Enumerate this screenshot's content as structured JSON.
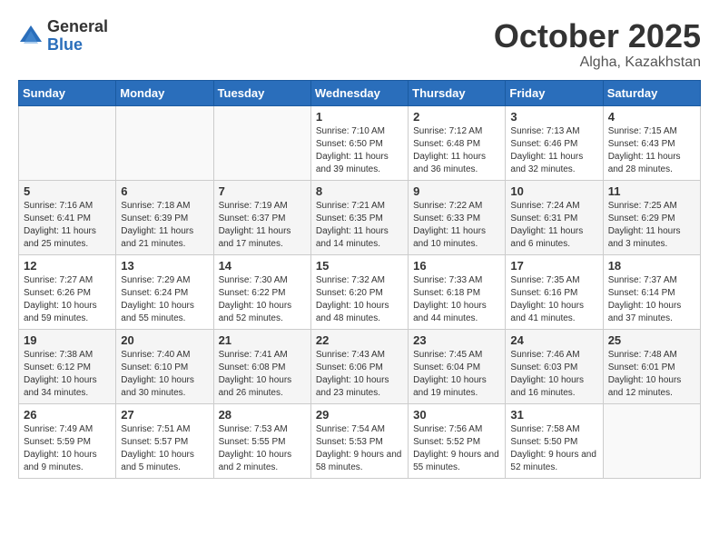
{
  "header": {
    "logo_general": "General",
    "logo_blue": "Blue",
    "month": "October 2025",
    "location": "Algha, Kazakhstan"
  },
  "weekdays": [
    "Sunday",
    "Monday",
    "Tuesday",
    "Wednesday",
    "Thursday",
    "Friday",
    "Saturday"
  ],
  "weeks": [
    [
      {
        "day": "",
        "info": ""
      },
      {
        "day": "",
        "info": ""
      },
      {
        "day": "",
        "info": ""
      },
      {
        "day": "1",
        "info": "Sunrise: 7:10 AM\nSunset: 6:50 PM\nDaylight: 11 hours and 39 minutes."
      },
      {
        "day": "2",
        "info": "Sunrise: 7:12 AM\nSunset: 6:48 PM\nDaylight: 11 hours and 36 minutes."
      },
      {
        "day": "3",
        "info": "Sunrise: 7:13 AM\nSunset: 6:46 PM\nDaylight: 11 hours and 32 minutes."
      },
      {
        "day": "4",
        "info": "Sunrise: 7:15 AM\nSunset: 6:43 PM\nDaylight: 11 hours and 28 minutes."
      }
    ],
    [
      {
        "day": "5",
        "info": "Sunrise: 7:16 AM\nSunset: 6:41 PM\nDaylight: 11 hours and 25 minutes."
      },
      {
        "day": "6",
        "info": "Sunrise: 7:18 AM\nSunset: 6:39 PM\nDaylight: 11 hours and 21 minutes."
      },
      {
        "day": "7",
        "info": "Sunrise: 7:19 AM\nSunset: 6:37 PM\nDaylight: 11 hours and 17 minutes."
      },
      {
        "day": "8",
        "info": "Sunrise: 7:21 AM\nSunset: 6:35 PM\nDaylight: 11 hours and 14 minutes."
      },
      {
        "day": "9",
        "info": "Sunrise: 7:22 AM\nSunset: 6:33 PM\nDaylight: 11 hours and 10 minutes."
      },
      {
        "day": "10",
        "info": "Sunrise: 7:24 AM\nSunset: 6:31 PM\nDaylight: 11 hours and 6 minutes."
      },
      {
        "day": "11",
        "info": "Sunrise: 7:25 AM\nSunset: 6:29 PM\nDaylight: 11 hours and 3 minutes."
      }
    ],
    [
      {
        "day": "12",
        "info": "Sunrise: 7:27 AM\nSunset: 6:26 PM\nDaylight: 10 hours and 59 minutes."
      },
      {
        "day": "13",
        "info": "Sunrise: 7:29 AM\nSunset: 6:24 PM\nDaylight: 10 hours and 55 minutes."
      },
      {
        "day": "14",
        "info": "Sunrise: 7:30 AM\nSunset: 6:22 PM\nDaylight: 10 hours and 52 minutes."
      },
      {
        "day": "15",
        "info": "Sunrise: 7:32 AM\nSunset: 6:20 PM\nDaylight: 10 hours and 48 minutes."
      },
      {
        "day": "16",
        "info": "Sunrise: 7:33 AM\nSunset: 6:18 PM\nDaylight: 10 hours and 44 minutes."
      },
      {
        "day": "17",
        "info": "Sunrise: 7:35 AM\nSunset: 6:16 PM\nDaylight: 10 hours and 41 minutes."
      },
      {
        "day": "18",
        "info": "Sunrise: 7:37 AM\nSunset: 6:14 PM\nDaylight: 10 hours and 37 minutes."
      }
    ],
    [
      {
        "day": "19",
        "info": "Sunrise: 7:38 AM\nSunset: 6:12 PM\nDaylight: 10 hours and 34 minutes."
      },
      {
        "day": "20",
        "info": "Sunrise: 7:40 AM\nSunset: 6:10 PM\nDaylight: 10 hours and 30 minutes."
      },
      {
        "day": "21",
        "info": "Sunrise: 7:41 AM\nSunset: 6:08 PM\nDaylight: 10 hours and 26 minutes."
      },
      {
        "day": "22",
        "info": "Sunrise: 7:43 AM\nSunset: 6:06 PM\nDaylight: 10 hours and 23 minutes."
      },
      {
        "day": "23",
        "info": "Sunrise: 7:45 AM\nSunset: 6:04 PM\nDaylight: 10 hours and 19 minutes."
      },
      {
        "day": "24",
        "info": "Sunrise: 7:46 AM\nSunset: 6:03 PM\nDaylight: 10 hours and 16 minutes."
      },
      {
        "day": "25",
        "info": "Sunrise: 7:48 AM\nSunset: 6:01 PM\nDaylight: 10 hours and 12 minutes."
      }
    ],
    [
      {
        "day": "26",
        "info": "Sunrise: 7:49 AM\nSunset: 5:59 PM\nDaylight: 10 hours and 9 minutes."
      },
      {
        "day": "27",
        "info": "Sunrise: 7:51 AM\nSunset: 5:57 PM\nDaylight: 10 hours and 5 minutes."
      },
      {
        "day": "28",
        "info": "Sunrise: 7:53 AM\nSunset: 5:55 PM\nDaylight: 10 hours and 2 minutes."
      },
      {
        "day": "29",
        "info": "Sunrise: 7:54 AM\nSunset: 5:53 PM\nDaylight: 9 hours and 58 minutes."
      },
      {
        "day": "30",
        "info": "Sunrise: 7:56 AM\nSunset: 5:52 PM\nDaylight: 9 hours and 55 minutes."
      },
      {
        "day": "31",
        "info": "Sunrise: 7:58 AM\nSunset: 5:50 PM\nDaylight: 9 hours and 52 minutes."
      },
      {
        "day": "",
        "info": ""
      }
    ]
  ]
}
